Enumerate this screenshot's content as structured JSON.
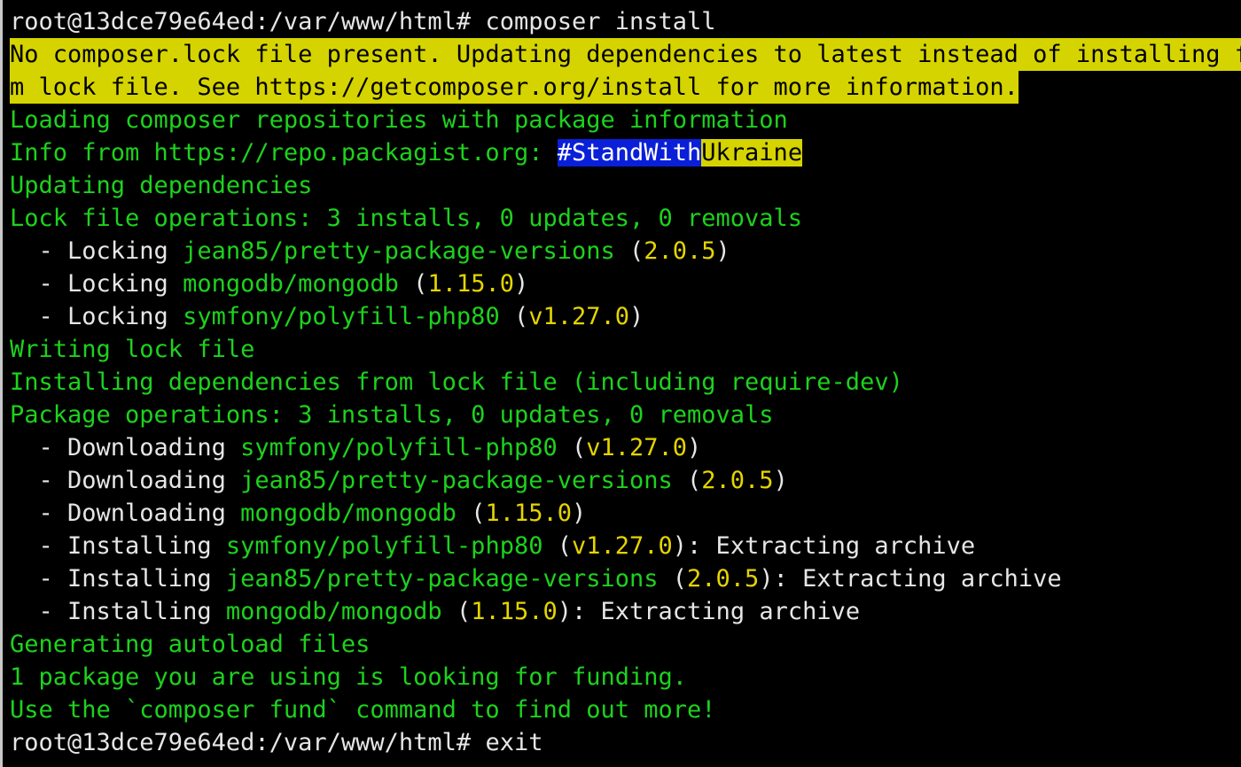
{
  "window": {
    "type": "terminal",
    "colors": {
      "background": "#000000",
      "default_text": "#e6e6e6",
      "info_green": "#1dd21d",
      "version_yellow": "#e5d400",
      "warning_bg": "#d6d400",
      "ukraine_blue": "#0a1fd8",
      "ukraine_yellow": "#d6d400"
    }
  },
  "terminal": {
    "top_partial": "root@13dce79e64ed:/var/www/html# composer install",
    "prompt1": "root@13dce79e64ed:/var/www/html# ",
    "command1": "composer install",
    "warning_line1": "No composer.lock file present. Updating dependencies to latest instead of installing f",
    "warning_line2": "m lock file. See https://getcomposer.org/install for more information.",
    "loading_repos": "Loading composer repositories with package information",
    "info_prefix": "Info from https://repo.packagist.org: ",
    "info_blue": "#StandWith",
    "info_yellow": "Ukraine",
    "updating": "Updating dependencies",
    "lock_ops": "Lock file operations: 3 installs, 0 updates, 0 removals",
    "lock_items": [
      {
        "action": "  - Locking ",
        "pkg": "jean85/pretty-package-versions",
        "ver": "2.0.5"
      },
      {
        "action": "  - Locking ",
        "pkg": "mongodb/mongodb",
        "ver": "1.15.0"
      },
      {
        "action": "  - Locking ",
        "pkg": "symfony/polyfill-php80",
        "ver": "v1.27.0"
      }
    ],
    "writing_lock": "Writing lock file",
    "installing_deps": "Installing dependencies from lock file (including require-dev)",
    "pkg_ops": "Package operations: 3 installs, 0 updates, 0 removals",
    "download_items": [
      {
        "action": "  - Downloading ",
        "pkg": "symfony/polyfill-php80",
        "ver": "v1.27.0"
      },
      {
        "action": "  - Downloading ",
        "pkg": "jean85/pretty-package-versions",
        "ver": "2.0.5"
      },
      {
        "action": "  - Downloading ",
        "pkg": "mongodb/mongodb",
        "ver": "1.15.0"
      }
    ],
    "install_items": [
      {
        "action": "  - Installing ",
        "pkg": "symfony/polyfill-php80",
        "ver": "v1.27.0",
        "suffix": ": Extracting archive"
      },
      {
        "action": "  - Installing ",
        "pkg": "jean85/pretty-package-versions",
        "ver": "2.0.5",
        "suffix": ": Extracting archive"
      },
      {
        "action": "  - Installing ",
        "pkg": "mongodb/mongodb",
        "ver": "1.15.0",
        "suffix": ": Extracting archive"
      }
    ],
    "generating": "Generating autoload files",
    "funding1": "1 package you are using is looking for funding.",
    "funding2": "Use the `composer fund` command to find out more!",
    "prompt2": "root@13dce79e64ed:/var/www/html# ",
    "command2": "exit"
  }
}
